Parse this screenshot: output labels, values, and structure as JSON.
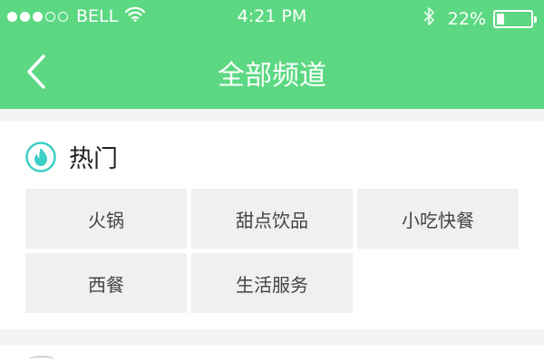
{
  "status_bar": {
    "signal_filled": 3,
    "signal_total": 5,
    "carrier": "BELL",
    "time": "4:21 PM",
    "battery_text": "22%",
    "battery_level": 0.22
  },
  "nav": {
    "title": "全部频道",
    "back_icon": "chevron-left-icon"
  },
  "sections": [
    {
      "title": "热门",
      "icon": "fire-icon",
      "items": [
        {
          "label": "火锅"
        },
        {
          "label": "甜点饮品"
        },
        {
          "label": "小吃快餐"
        },
        {
          "label": "西餐"
        },
        {
          "label": "生活服务"
        }
      ]
    }
  ],
  "colors": {
    "header_green": "#5cd882",
    "accent_teal": "#3ccfc4",
    "cell_bg": "#f0f0f0",
    "page_bg": "#f4f4f4"
  }
}
